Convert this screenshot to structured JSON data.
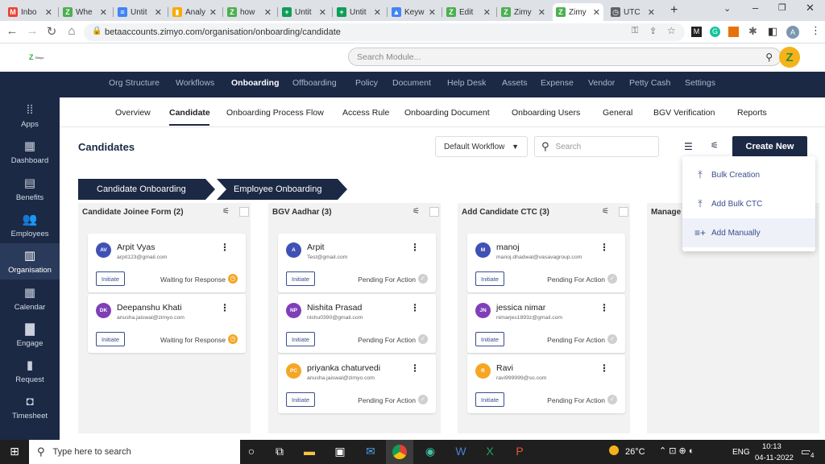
{
  "browser": {
    "tabs": [
      {
        "title": "Inbo",
        "icon": "gmail-icon",
        "color": "#ea4335",
        "glyph": "M"
      },
      {
        "title": "Whe",
        "icon": "zimyo-icon",
        "color": "#4caf50",
        "glyph": "Z"
      },
      {
        "title": "Untit",
        "icon": "docs-icon",
        "color": "#4285f4",
        "glyph": "≡"
      },
      {
        "title": "Analy",
        "icon": "analytics-icon",
        "color": "#f9ab00",
        "glyph": "▮"
      },
      {
        "title": "how",
        "icon": "zimyo-icon",
        "color": "#4caf50",
        "glyph": "Z"
      },
      {
        "title": "Untit",
        "icon": "sheets-icon",
        "color": "#0f9d58",
        "glyph": "+"
      },
      {
        "title": "Untit",
        "icon": "sheets-icon",
        "color": "#0f9d58",
        "glyph": "+"
      },
      {
        "title": "Keyw",
        "icon": "ads-icon",
        "color": "#4285f4",
        "glyph": "▲"
      },
      {
        "title": "Edit",
        "icon": "zimyo-icon",
        "color": "#4caf50",
        "glyph": "Z"
      },
      {
        "title": "Zimy",
        "icon": "zimyo-icon",
        "color": "#4caf50",
        "glyph": "Z"
      },
      {
        "title": "Zimy",
        "icon": "zimyo-icon",
        "color": "#4caf50",
        "glyph": "Z"
      },
      {
        "title": "UTC",
        "icon": "clock-icon",
        "color": "#5f6368",
        "glyph": "◷"
      }
    ],
    "url": "betaaccounts.zimyo.com/organisation/onboarding/candidate",
    "profile": "A"
  },
  "header": {
    "logo_text": "Zimyo",
    "search_placeholder": "Search Module..."
  },
  "topnav": [
    "Org Structure",
    "Workflows",
    "Onboarding",
    "Offboarding",
    "Policy",
    "Document",
    "Help Desk",
    "Assets",
    "Expense",
    "Vendor",
    "Petty Cash",
    "Settings"
  ],
  "sidebar": [
    {
      "label": "Apps",
      "icon": "apps-icon"
    },
    {
      "label": "Dashboard",
      "icon": "dashboard-icon"
    },
    {
      "label": "Benefits",
      "icon": "benefits-icon"
    },
    {
      "label": "Employees",
      "icon": "employees-icon"
    },
    {
      "label": "Organisation",
      "icon": "organisation-icon"
    },
    {
      "label": "Calendar",
      "icon": "calendar-icon"
    },
    {
      "label": "Engage",
      "icon": "engage-icon"
    },
    {
      "label": "Request",
      "icon": "request-icon"
    },
    {
      "label": "Timesheet",
      "icon": "timesheet-icon"
    }
  ],
  "subnav": [
    "Overview",
    "Candidate",
    "Onboarding Process Flow",
    "Access Rule",
    "Onboarding Document",
    "Onboarding Users",
    "General",
    "BGV Verification",
    "Reports"
  ],
  "page": {
    "title": "Candidates",
    "workflow_select": "Default Workflow",
    "search_placeholder": "Search",
    "create_new": "Create New",
    "stage_tabs": [
      "Candidate Onboarding",
      "Employee Onboarding"
    ]
  },
  "dropdown": [
    {
      "label": "Bulk Creation",
      "icon": "upload-icon"
    },
    {
      "label": "Add Bulk CTC",
      "icon": "upload-icon"
    },
    {
      "label": "Add Manually",
      "icon": "add-list-icon"
    }
  ],
  "columns": [
    {
      "title": "Candidate Joinee Form (2)",
      "cards": [
        {
          "initials": "AV",
          "name": "Arpit Vyas",
          "email": "arpit123@gmail.com",
          "action": "Initiate",
          "status": "Waiting for Response",
          "avatar_color": "#3f51b5",
          "status_color": "#f5a623"
        },
        {
          "initials": "DK",
          "name": "Deepanshu Khati",
          "email": "anusha.jaiswal@zimyo.com",
          "action": "Initiate",
          "status": "Waiting for Response",
          "avatar_color": "#7e3fb8",
          "status_color": "#f5a623"
        }
      ]
    },
    {
      "title": "BGV Aadhar (3)",
      "cards": [
        {
          "initials": "A",
          "name": "Arpit",
          "email": "Test@gmail.com",
          "action": "Initiate",
          "status": "Pending For Action",
          "avatar_color": "#3f51b5",
          "status_color": "#cfcfcf"
        },
        {
          "initials": "NP",
          "name": "Nishita Prasad",
          "email": "nishu0390@gmail.com",
          "action": "Initiate",
          "status": "Pending For Action",
          "avatar_color": "#7e3fb8",
          "status_color": "#cfcfcf"
        },
        {
          "initials": "PC",
          "name": "priyanka chaturvedi",
          "email": "anusha.jaiswal@zimyo.com",
          "action": "Initiate",
          "status": "Pending For Action",
          "avatar_color": "#f5a623",
          "status_color": "#cfcfcf"
        }
      ]
    },
    {
      "title": "Add Candidate CTC (3)",
      "cards": [
        {
          "initials": "M",
          "name": "manoj",
          "email": "manoj.dhadwal@vasavagroup.com",
          "action": "Initiate",
          "status": "Pending For Action",
          "avatar_color": "#3f51b5",
          "status_color": "#cfcfcf"
        },
        {
          "initials": "JN",
          "name": "jessica nimar",
          "email": "nimarjes1893z@gmail.com",
          "action": "Initiate",
          "status": "Pending For Action",
          "avatar_color": "#7e3fb8",
          "status_color": "#cfcfcf"
        },
        {
          "initials": "R",
          "name": "Ravi",
          "email": "ravi999999@so.com",
          "action": "Initiate",
          "status": "Pending For Action",
          "avatar_color": "#f5a623",
          "status_color": "#cfcfcf"
        }
      ]
    },
    {
      "title": "Manage",
      "cards": []
    }
  ],
  "taskbar": {
    "search_placeholder": "Type here to search",
    "weather": "26°C",
    "lang": "ENG",
    "time": "10:13",
    "date": "04-11-2022",
    "notifications": "4"
  },
  "colors": {
    "navy": "#1b2945",
    "accent": "#3a4d8f"
  }
}
